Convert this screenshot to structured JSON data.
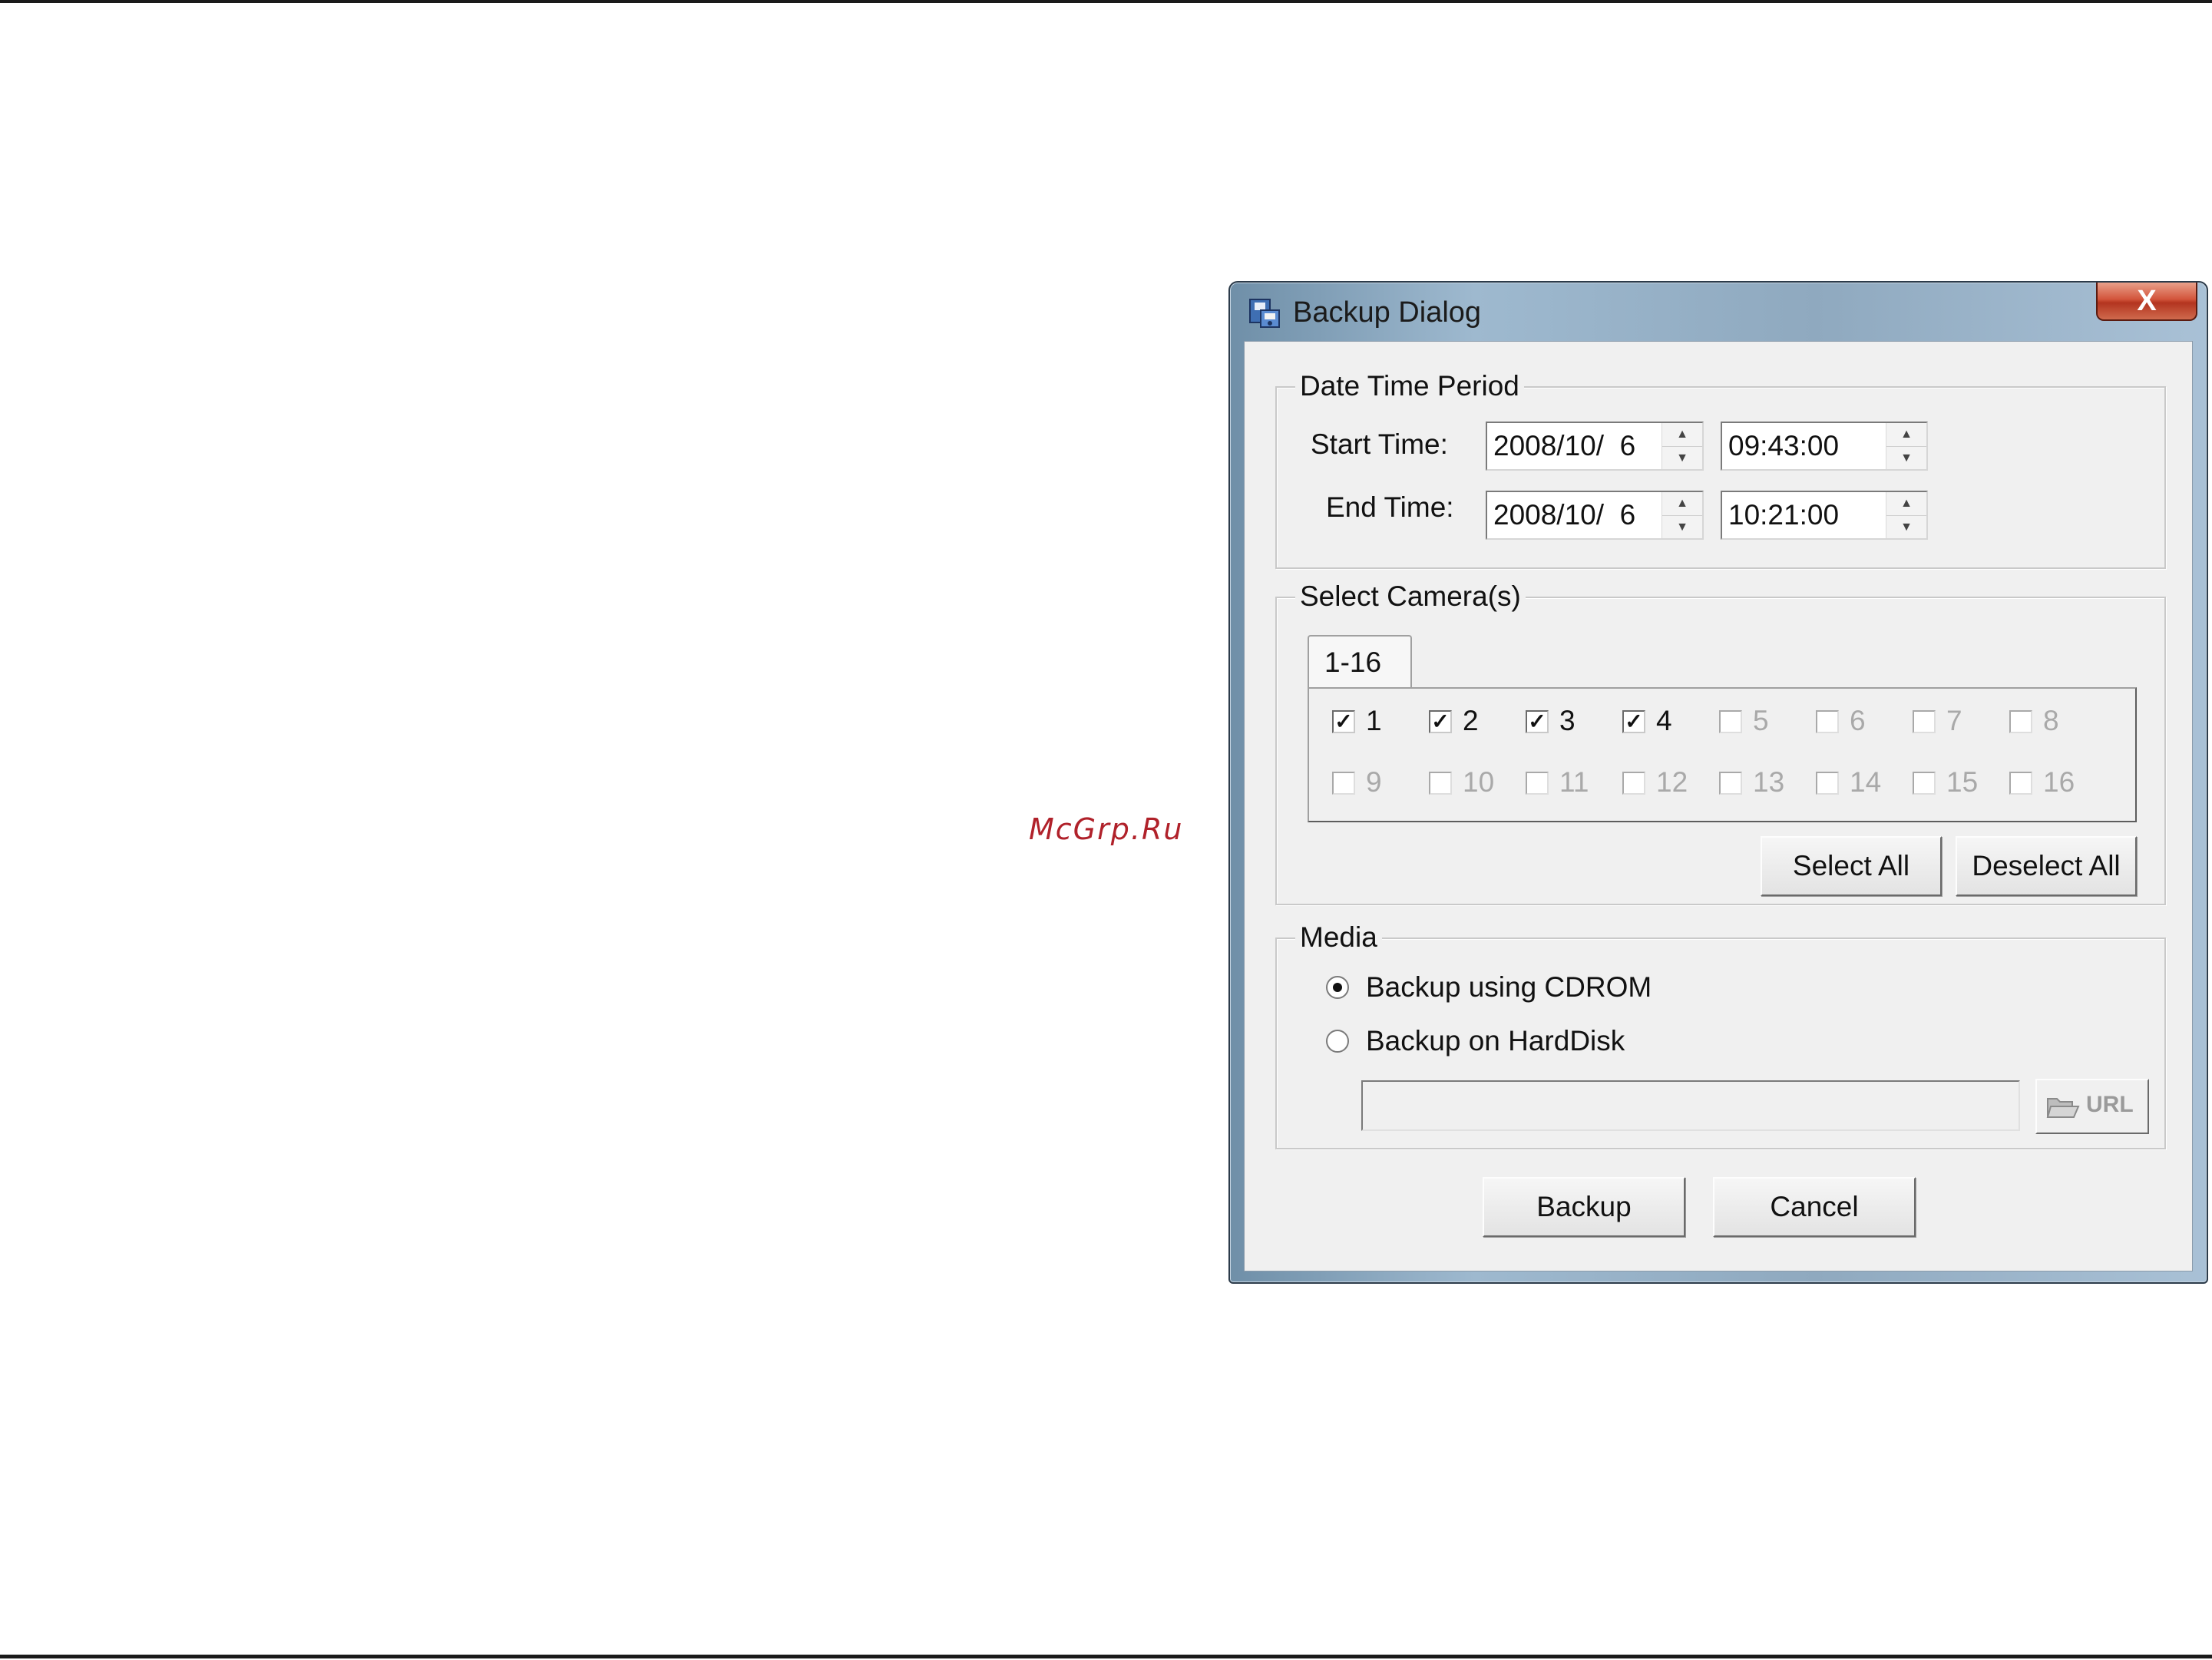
{
  "watermark": "McGrp.Ru",
  "dialog": {
    "title": "Backup Dialog",
    "close_label": "X",
    "date_time": {
      "legend": "Date Time Period",
      "start_label": "Start Time:",
      "start_date": "2008/10/  6",
      "start_time": "09:43:00",
      "end_label": "End Time:",
      "end_date": "2008/10/  6",
      "end_time": "10:21:00"
    },
    "cameras": {
      "legend": "Select Camera(s)",
      "tab_label": "1-16",
      "items": [
        {
          "label": "1",
          "checked": true,
          "enabled": true
        },
        {
          "label": "2",
          "checked": true,
          "enabled": true
        },
        {
          "label": "3",
          "checked": true,
          "enabled": true
        },
        {
          "label": "4",
          "checked": true,
          "enabled": true
        },
        {
          "label": "5",
          "checked": false,
          "enabled": false
        },
        {
          "label": "6",
          "checked": false,
          "enabled": false
        },
        {
          "label": "7",
          "checked": false,
          "enabled": false
        },
        {
          "label": "8",
          "checked": false,
          "enabled": false
        },
        {
          "label": "9",
          "checked": false,
          "enabled": false
        },
        {
          "label": "10",
          "checked": false,
          "enabled": false
        },
        {
          "label": "11",
          "checked": false,
          "enabled": false
        },
        {
          "label": "12",
          "checked": false,
          "enabled": false
        },
        {
          "label": "13",
          "checked": false,
          "enabled": false
        },
        {
          "label": "14",
          "checked": false,
          "enabled": false
        },
        {
          "label": "15",
          "checked": false,
          "enabled": false
        },
        {
          "label": "16",
          "checked": false,
          "enabled": false
        }
      ],
      "select_all_label": "Select All",
      "deselect_all_label": "Deselect All"
    },
    "media": {
      "legend": "Media",
      "options": [
        {
          "label": "Backup using CDROM",
          "selected": true
        },
        {
          "label": "Backup on HardDisk",
          "selected": false
        }
      ],
      "path_value": "",
      "url_button_label": "URL"
    },
    "backup_label": "Backup",
    "cancel_label": "Cancel"
  }
}
